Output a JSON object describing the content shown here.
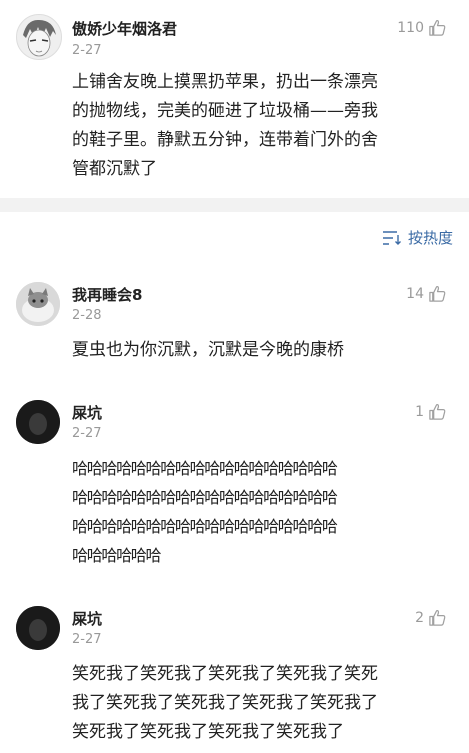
{
  "post": {
    "author": "傲娇少年烟洛君",
    "date": "2-27",
    "likes": "110",
    "text": "上铺舍友晚上摸黑扔苹果，扔出一条漂亮\n的抛物线，完美的砸进了垃圾桶——旁我\n的鞋子里。静默五分钟，连带着门外的舍\n管都沉默了"
  },
  "sort": {
    "label": "按热度",
    "icon": "sort-lines-icon",
    "color": "#3b6ba5"
  },
  "comments": [
    {
      "author": "我再睡会8",
      "date": "2-28",
      "likes": "14",
      "text": "夏虫也为你沉默，沉默是今晚的康桥"
    },
    {
      "author": "屎坑",
      "date": "2-27",
      "likes": "1",
      "text": "哈哈哈哈哈哈哈哈哈哈哈哈哈哈哈哈哈哈\n哈哈哈哈哈哈哈哈哈哈哈哈哈哈哈哈哈哈\n哈哈哈哈哈哈哈哈哈哈哈哈哈哈哈哈哈哈\n哈哈哈哈哈哈"
    },
    {
      "author": "屎坑",
      "date": "2-27",
      "likes": "2",
      "text": "笑死我了笑死我了笑死我了笑死我了笑死\n我了笑死我了笑死我了笑死我了笑死我了\n笑死我了笑死我了笑死我了笑死我了"
    }
  ]
}
